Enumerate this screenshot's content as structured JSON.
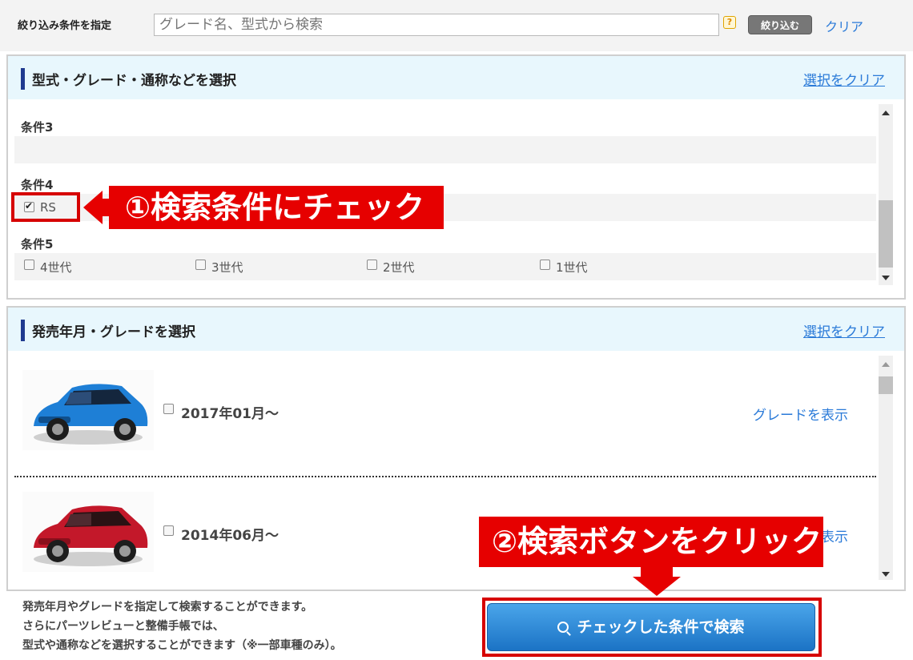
{
  "filter_bar": {
    "label": "絞り込み条件を指定",
    "placeholder": "グレード名、型式から検索",
    "help_icon": "?",
    "narrow_button": "絞り込む",
    "clear_link": "クリア"
  },
  "conditions_panel": {
    "title": "型式・グレード・通称などを選択",
    "clear_link": "選択をクリア",
    "condition3": {
      "title": "条件3"
    },
    "condition4": {
      "title": "条件4",
      "options": [
        {
          "label": "RS",
          "checked": true
        }
      ]
    },
    "condition5": {
      "title": "条件5",
      "options": [
        {
          "label": "4世代",
          "checked": false
        },
        {
          "label": "3世代",
          "checked": false
        },
        {
          "label": "2世代",
          "checked": false
        },
        {
          "label": "1世代",
          "checked": false
        }
      ]
    }
  },
  "grade_panel": {
    "title": "発売年月・グレードを選択",
    "clear_link": "選択をクリア",
    "rows": [
      {
        "date": "2017年01月～",
        "show_grade": "グレードを表示",
        "car_icon": "blue-hatchback-car",
        "color": "#1e7fd6"
      },
      {
        "date": "2014年06月～",
        "show_grade": "グレードを表示",
        "car_icon": "red-hatchback-car",
        "color": "#c3182a"
      }
    ]
  },
  "callouts": {
    "step1": "①検索条件にチェック",
    "step2": "②検索ボタンをクリック"
  },
  "footer": {
    "line1": "発売年月やグレードを指定して検索することができます。",
    "line2": "さらにパーツレビューと整備手帳では、",
    "line3": "型式や通称などを選択することができます（※一部車種のみ）。",
    "search_button": "チェックした条件で検索",
    "search_icon": "magnifier-icon"
  }
}
